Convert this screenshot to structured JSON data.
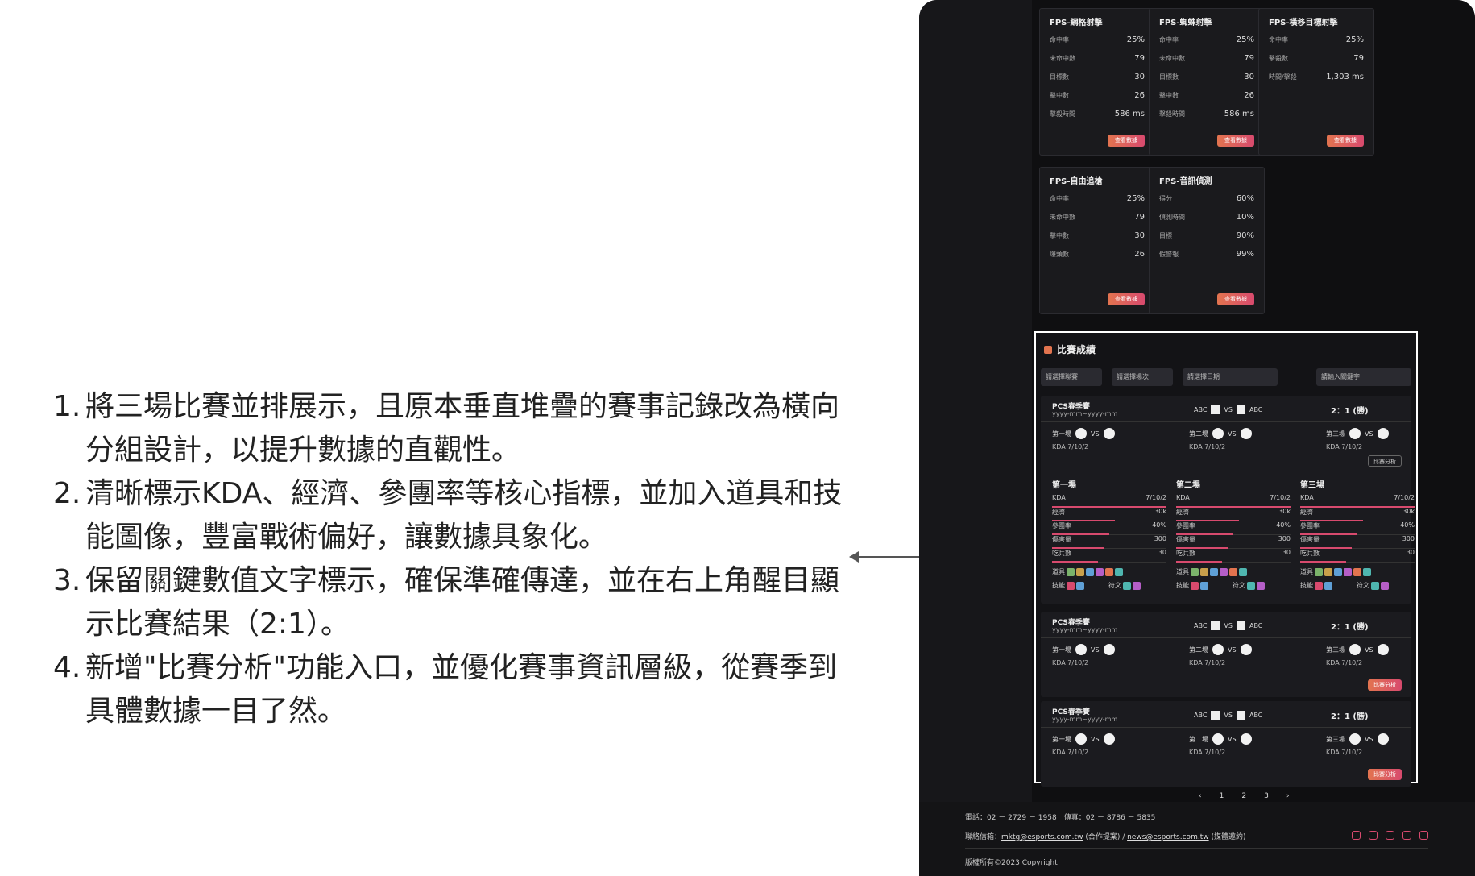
{
  "notes": [
    {
      "num": "1.",
      "text": "將三場比賽並排展示，且原本垂直堆疊的賽事記錄改為橫向分組設計，以提升數據的直觀性。"
    },
    {
      "num": "2.",
      "text": "清晰標示KDA、經濟、參團率等核心指標，並加入道具和技能圖像，豐富戰術偏好，讓數據具象化。"
    },
    {
      "num": "3.",
      "text": "保留關鍵數值文字標示，確保準確傳達，並在右上角醒目顯示比賽結果（2:1）。"
    },
    {
      "num": "4.",
      "text": "新增\"比賽分析\"功能入口，並優化賽事資訊層級，從賽季到具體數據一目了然。"
    }
  ],
  "cards": [
    {
      "title": "FPS-網格射擊",
      "rows": [
        [
          "命中率",
          "25%"
        ],
        [
          "未命中數",
          "79"
        ],
        [
          "目標數",
          "30"
        ],
        [
          "擊中數",
          "26"
        ],
        [
          "擊殺時間",
          "586 ms"
        ]
      ],
      "btn": "查看數據"
    },
    {
      "title": "FPS-蜘蛛射擊",
      "rows": [
        [
          "命中率",
          "25%"
        ],
        [
          "未命中數",
          "79"
        ],
        [
          "目標數",
          "30"
        ],
        [
          "擊中數",
          "26"
        ],
        [
          "擊殺時間",
          "586 ms"
        ]
      ],
      "btn": "查看數據"
    },
    {
      "title": "FPS-橫移目標射擊",
      "rows": [
        [
          "命中率",
          "25%"
        ],
        [
          "擊殺數",
          "79"
        ],
        [
          "時間/擊殺",
          "1,303 ms"
        ]
      ],
      "btn": "查看數據"
    },
    {
      "title": "FPS-自由追槍",
      "rows": [
        [
          "命中率",
          "25%"
        ],
        [
          "未命中數",
          "79"
        ],
        [
          "擊中數",
          "30"
        ],
        [
          "爆頭數",
          "26"
        ]
      ],
      "btn": "查看數據"
    },
    {
      "title": "FPS-音訊偵測",
      "rows": [
        [
          "得分",
          "60%"
        ],
        [
          "偵測時間",
          "10%"
        ],
        [
          "目標",
          "90%"
        ],
        [
          "假警報",
          "99%"
        ]
      ],
      "btn": "查看數據"
    }
  ],
  "panel": {
    "title": "比賽成績",
    "filters": [
      "請選擇聯賽",
      "請選擇場次",
      "請選擇日期",
      "請輸入關鍵字"
    ],
    "games": [
      {
        "title": "PCS春季賽",
        "date": "yyyy-mm~yyyy-mm",
        "teamA": "ABC",
        "vs": "VS",
        "teamB": "ABC",
        "score": "2：1 (勝)",
        "btn": "比賽分析",
        "sets": [
          {
            "label": "第一場",
            "vs": "VS",
            "kda": "KDA  7/10/2"
          },
          {
            "label": "第二場",
            "vs": "VS",
            "kda": "KDA  7/10/2"
          },
          {
            "label": "第三場",
            "vs": "VS",
            "kda": "KDA  7/10/2"
          }
        ]
      },
      {
        "title": "PCS春季賽",
        "date": "yyyy-mm~yyyy-mm",
        "teamA": "ABC",
        "vs": "VS",
        "teamB": "ABC",
        "score": "2：1 (勝)",
        "btn": "比賽分析",
        "sets": [
          {
            "label": "第一場",
            "vs": "VS",
            "kda": "KDA  7/10/2"
          },
          {
            "label": "第二場",
            "vs": "VS",
            "kda": "KDA  7/10/2"
          },
          {
            "label": "第三場",
            "vs": "VS",
            "kda": "KDA  7/10/2"
          }
        ]
      },
      {
        "title": "PCS春季賽",
        "date": "yyyy-mm~yyyy-mm",
        "teamA": "ABC",
        "vs": "VS",
        "teamB": "ABC",
        "score": "2：1 (勝)",
        "btn": "比賽分析",
        "sets": [
          {
            "label": "第一場",
            "vs": "VS",
            "kda": "KDA  7/10/2"
          },
          {
            "label": "第二場",
            "vs": "VS",
            "kda": "KDA  7/10/2"
          },
          {
            "label": "第三場",
            "vs": "VS",
            "kda": "KDA  7/10/2"
          }
        ]
      }
    ],
    "details": [
      {
        "title": "第一場",
        "rows": [
          [
            "KDA",
            "7/10/2"
          ],
          [
            "經濟",
            "30k"
          ],
          [
            "參團率",
            "40%"
          ],
          [
            "傷害量",
            "300"
          ],
          [
            "吃兵數",
            "30"
          ]
        ],
        "items": "道具",
        "skills": "技能",
        "runes": "符文"
      },
      {
        "title": "第二場",
        "rows": [
          [
            "KDA",
            "7/10/2"
          ],
          [
            "經濟",
            "30k"
          ],
          [
            "參團率",
            "40%"
          ],
          [
            "傷害量",
            "300"
          ],
          [
            "吃兵數",
            "30"
          ]
        ],
        "items": "道具",
        "skills": "技能",
        "runes": "符文"
      },
      {
        "title": "第三場",
        "rows": [
          [
            "KDA",
            "7/10/2"
          ],
          [
            "經濟",
            "30k"
          ],
          [
            "參團率",
            "40%"
          ],
          [
            "傷害量",
            "300"
          ],
          [
            "吃兵數",
            "30"
          ]
        ],
        "items": "道具",
        "skills": "技能",
        "runes": "符文"
      }
    ]
  },
  "pager": [
    "‹",
    "1",
    "2",
    "3",
    "›"
  ],
  "footer": {
    "phone": "電話：02 － 2729 － 1958　傳真：02 － 8786 － 5835",
    "contact_label": "聯絡信箱：",
    "email1": "mktg@esports.com.tw",
    "email1_note": "(合作提案) / ",
    "email2": "news@esports.com.tw",
    "email2_note": "(媒體邀約)",
    "copyright": "版權所有©2023 Copyright"
  },
  "colors": {
    "accent": "#e2744f",
    "accent2": "#d84a6e",
    "bg": "#0f0f11"
  }
}
